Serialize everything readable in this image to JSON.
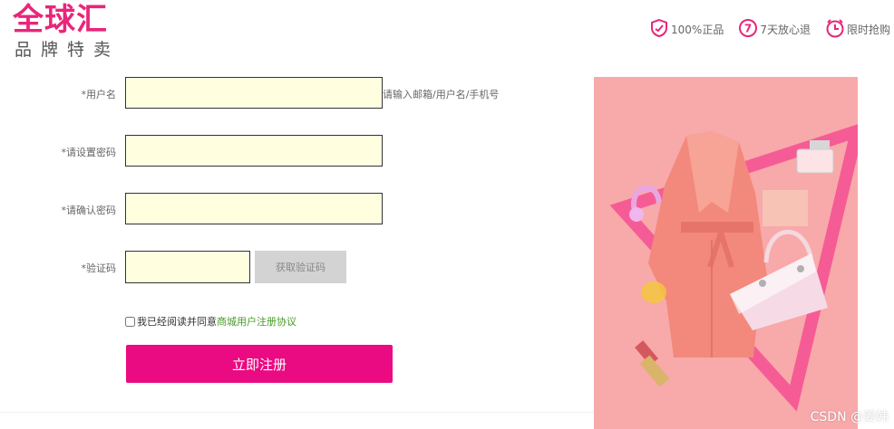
{
  "brand": {
    "name": "全球汇",
    "tagline": "品牌特卖"
  },
  "badges": [
    {
      "icon": "shield-check-icon",
      "label": "100%正品"
    },
    {
      "icon": "seven-day-return-icon",
      "label": "7天放心退"
    },
    {
      "icon": "clock-icon",
      "label": "限时抢购"
    }
  ],
  "form": {
    "username": {
      "label": "*用户名",
      "value": "",
      "hint": "请输入邮箱/用户名/手机号"
    },
    "password": {
      "label": "*请设置密码",
      "value": ""
    },
    "confirm_password": {
      "label": "*请确认密码",
      "value": ""
    },
    "captcha": {
      "label": "*验证码",
      "value": "",
      "button": "获取验证码"
    },
    "agreement": {
      "text": "我已经阅读并同意",
      "link": "商城用户注册协议",
      "checked": false
    },
    "submit": "立即注册"
  },
  "promo": {
    "icon": "fashion-promo-image"
  },
  "watermark": "CSDN @姜韩",
  "colors": {
    "brand": "#e8267a",
    "submit": "#ea0a82",
    "input_bg": "#ffffe0",
    "link": "#4a9a2a",
    "promo_bg": "#f8a9aa"
  }
}
